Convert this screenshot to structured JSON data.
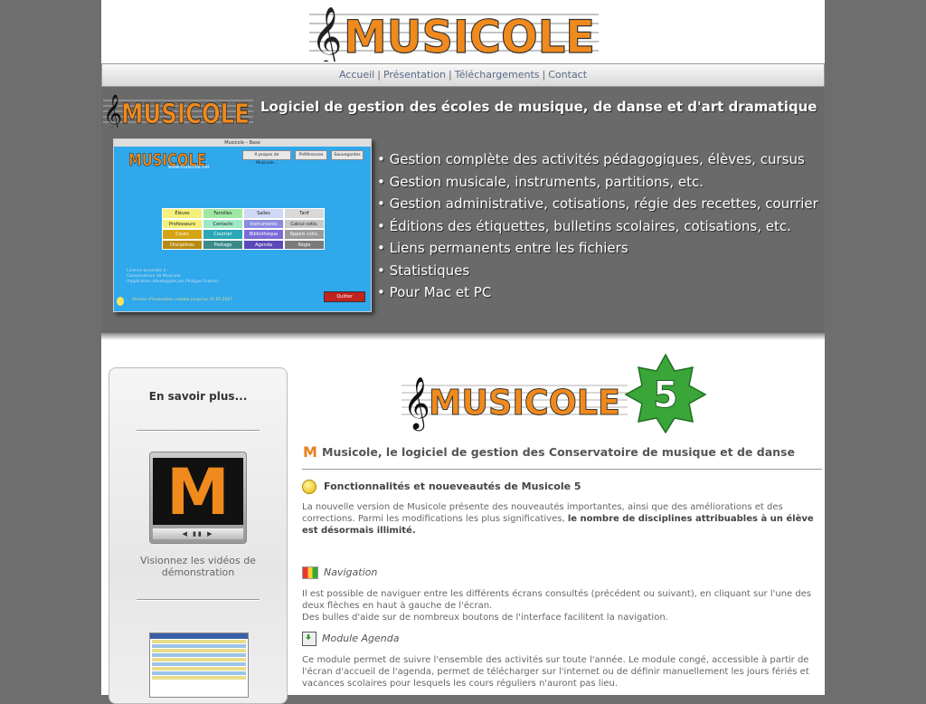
{
  "header": {
    "logo_text": "MUSICOLE"
  },
  "nav": {
    "items": [
      "Accueil",
      "Présentation",
      "Téléchargements",
      "Contact"
    ],
    "separator": "|"
  },
  "banner": {
    "logo_text": "MUSICOLE",
    "tagline": "Logiciel de gestion des écoles de musique, de danse et d'art dramatique",
    "screenshot": {
      "title": "Musicole – Base",
      "url": "www.musicole.net",
      "buttons": [
        "À propos de Musicole...",
        "Préférences",
        "Sauvegardes"
      ],
      "grid": [
        [
          "Élèves",
          "Familles",
          "Salles",
          "Tarif"
        ],
        [
          "Professeurs",
          "Contacts",
          "Instruments",
          "Calcul cotis."
        ],
        [
          "Cours",
          "Courrier",
          "Bibliothèque",
          "Appels cotis."
        ],
        [
          "Disciplines",
          "Postage",
          "Agenda",
          "Régie"
        ]
      ],
      "info_lines": [
        "Licence accordée à :",
        "Conservatoire de Musicole",
        "(Application développée par Philippe Gratier)"
      ],
      "warning": "Version d'évaluation valable jusqu'au 31.05.2007",
      "quit_label": "Quitter"
    },
    "features": [
      "• Gestion complète des activités pédagogiques, élèves, cursus",
      "• Gestion musicale, instruments, partitions, etc.",
      "• Gestion administrative, cotisations, régie des recettes, courrier",
      "• Éditions des étiquettes, bulletins scolaires, cotisations, etc.",
      "• Liens permanents entre les fichiers",
      "• Statistiques",
      "• Pour Mac et PC"
    ]
  },
  "sidebar": {
    "title": "En savoir plus...",
    "video_caption": "Visionnez les vidéos de démonstration",
    "video_letter": "M",
    "video_controls": "◀ ▮▮ ▶"
  },
  "main": {
    "logo_text": "MUSICOLE",
    "version_badge": "5",
    "heading": "Musicole, le logiciel de gestion des Conservatoire de musique et de danse",
    "heading_icon_letter": "M",
    "section_title": "Fonctionnalités et noueveautés de Musicole 5",
    "intro_text": "La nouvelle version de Musicole présente des nouveautés importantes, ainsi que des améliorations et des corrections. Parmi les modifications les plus significatives,",
    "intro_bold": "le nombre de disciplines attribuables à un élève est désormais illimité.",
    "navigation_title": "Navigation",
    "navigation_text_1": "Il est possible de naviguer entre les différents écrans consultés (précédent ou suivant), en cliquant sur l'une des deux flèches en haut à gauche de l'écran.",
    "navigation_text_2": "Des bulles d'aide sur de nombreux boutons de l'interface facilitent la navigation.",
    "agenda_title": "Module Agenda",
    "agenda_text": "Ce module permet de suivre l'ensemble des activités sur toute l'année. Le module congé, accessible à partir de l'écran d'accueil de l'agenda, permet de télécharger sur l'internet ou de définir manuellement les jours fériés et vacances scolaires pour lesquels les cours réguliers n'auront pas lieu."
  },
  "colors": {
    "background": "#6e6e6e",
    "logo_orange": "#f08a1c",
    "badge_green": "#3aa63a",
    "banner": "#6a6a6a"
  }
}
